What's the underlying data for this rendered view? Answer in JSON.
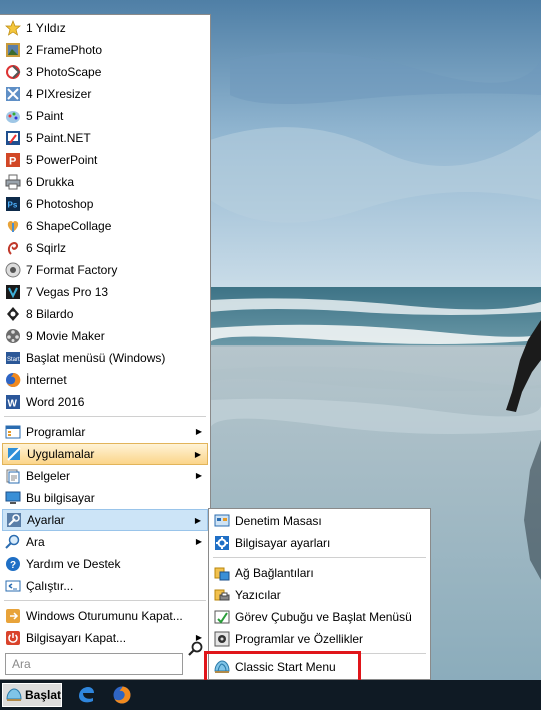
{
  "menu": {
    "recent": [
      {
        "label": "1 Yıldız",
        "icon": "star-icon"
      },
      {
        "label": "2 FramePhoto",
        "icon": "framephoto-icon"
      },
      {
        "label": "3 PhotoScape",
        "icon": "photoscape-icon"
      },
      {
        "label": "4 PIXresizer",
        "icon": "pixresizer-icon"
      },
      {
        "label": "5 Paint",
        "icon": "paint-icon"
      },
      {
        "label": "5 Paint.NET",
        "icon": "paintnet-icon"
      },
      {
        "label": "5 PowerPoint",
        "icon": "powerpoint-icon"
      },
      {
        "label": "6 Drukka",
        "icon": "printer-icon"
      },
      {
        "label": "6 Photoshop",
        "icon": "photoshop-icon"
      },
      {
        "label": "6 ShapeCollage",
        "icon": "shapecollage-icon"
      },
      {
        "label": "6 Sqirlz",
        "icon": "sqirlz-icon"
      },
      {
        "label": "7 Format Factory",
        "icon": "formatfactory-icon"
      },
      {
        "label": "7 Vegas Pro 13",
        "icon": "vegas-icon"
      },
      {
        "label": "8 Bilardo",
        "icon": "billiards-icon"
      },
      {
        "label": "9 Movie Maker",
        "icon": "moviemaker-icon"
      },
      {
        "label": "Başlat menüsü (Windows)",
        "icon": "start-menu-icon"
      },
      {
        "label": "İnternet",
        "icon": "firefox-icon"
      },
      {
        "label": "Word 2016",
        "icon": "word-icon"
      }
    ],
    "main": [
      {
        "label": "Programlar",
        "icon": "programs-icon"
      },
      {
        "label": "Uygulamalar",
        "icon": "apps-icon"
      },
      {
        "label": "Belgeler",
        "icon": "documents-icon"
      },
      {
        "label": "Bu bilgisayar",
        "icon": "computer-icon"
      },
      {
        "label": "Ayarlar",
        "icon": "settings-icon"
      },
      {
        "label": "Ara",
        "icon": "search-icon"
      },
      {
        "label": "Yardım ve Destek",
        "icon": "help-icon"
      },
      {
        "label": "Çalıştır...",
        "icon": "run-icon"
      }
    ],
    "power": [
      {
        "label": "Windows Oturumunu Kapat...",
        "icon": "logoff-icon"
      },
      {
        "label": "Bilgisayarı Kapat...",
        "icon": "shutdown-icon"
      }
    ],
    "search_placeholder": "Ara"
  },
  "submenu": {
    "items": [
      {
        "label": "Denetim Masası",
        "icon": "control-panel-icon"
      },
      {
        "label": "Bilgisayar ayarları",
        "icon": "pc-settings-icon"
      },
      {
        "label": "Ağ Bağlantıları",
        "icon": "network-icon"
      },
      {
        "label": "Yazıcılar",
        "icon": "printers-icon"
      },
      {
        "label": "Görev Çubuğu ve Başlat Menüsü",
        "icon": "taskbar-icon"
      },
      {
        "label": "Programlar ve Özellikler",
        "icon": "programs-features-icon"
      },
      {
        "label": "Classic Start Menu",
        "icon": "classic-shell-icon"
      }
    ]
  },
  "taskbar": {
    "start_label": "Başlat"
  },
  "colors": {
    "highlight_red": "#e0151a",
    "selected_blue": "#cce4f7",
    "hover_orange": "#fbd58a",
    "taskbar": "#0f1a24"
  }
}
